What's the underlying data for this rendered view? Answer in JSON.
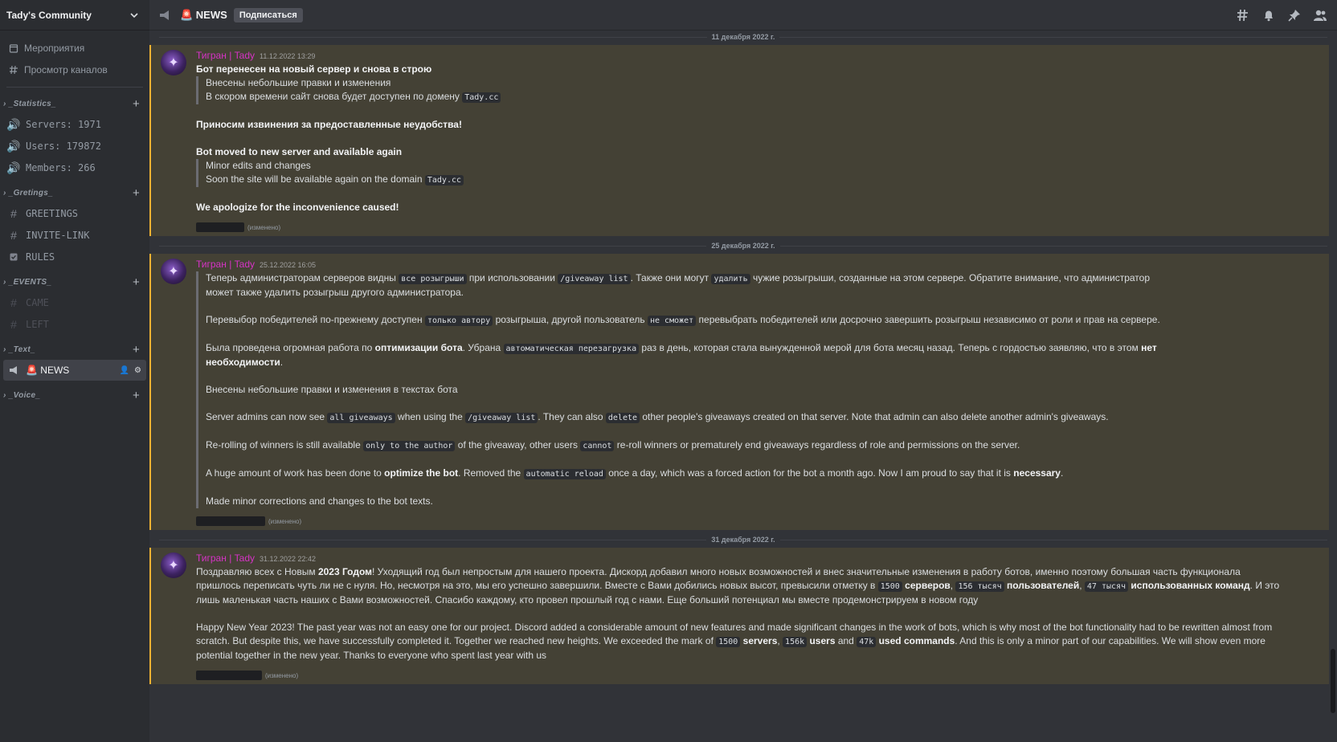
{
  "server": {
    "name": "Tady's Community"
  },
  "sidebar": {
    "top_items": [
      {
        "icon": "calendar-icon",
        "label": "Мероприятия"
      },
      {
        "icon": "browse-channels-icon",
        "label": "Просмотр каналов"
      }
    ],
    "categories": [
      {
        "name": "_Statistics_",
        "channels": [
          {
            "icon": "voice-icon",
            "label": "Servers: 1971"
          },
          {
            "icon": "voice-icon",
            "label": "Users: 179872"
          },
          {
            "icon": "voice-icon",
            "label": "Members: 266"
          }
        ]
      },
      {
        "name": "_Gretings_",
        "channels": [
          {
            "icon": "hash-icon",
            "label": "GREETINGS"
          },
          {
            "icon": "hash-icon",
            "label": "INVITE-LINK"
          },
          {
            "icon": "rules-icon",
            "label": "RULES"
          }
        ]
      },
      {
        "name": "_EVENTS_",
        "channels": [
          {
            "icon": "hash-icon",
            "label": "CAME"
          },
          {
            "icon": "hash-icon",
            "label": "LEFT"
          }
        ]
      },
      {
        "name": "_Text_",
        "channels": [
          {
            "icon": "announcement-icon",
            "label": "🚨 NEWS"
          }
        ]
      },
      {
        "name": "_Voice_",
        "channels": []
      }
    ]
  },
  "topbar": {
    "channel": "🚨 NEWS",
    "follow_label": "Подписаться",
    "icons": [
      "threads-icon",
      "bell-icon",
      "pin-icon",
      "members-icon"
    ]
  },
  "messages": [
    {
      "date_divider": "11 декабря 2022 г.",
      "author": "Тигран | Tady",
      "timestamp": "11.12.2022 13:29",
      "edited": "(изменено)"
    },
    {
      "date_divider": "25 декабря 2022 г.",
      "author": "Тигран | Tady",
      "timestamp": "25.12.2022 16:05",
      "edited": "(изменено)"
    },
    {
      "date_divider": "31 декабря 2022 г.",
      "author": "Тигран | Tady",
      "timestamp": "31.12.2022 22:42",
      "edited": "(изменено)"
    }
  ],
  "m1": {
    "ru_title": "Бот перенесен на новый сервер и снова в строю",
    "ru_q1": "Внесены небольшие правки и изменения",
    "ru_q2a": "В скором времени сайт снова будет доступен по домену ",
    "domain": "Tady.cc",
    "ru_apology": "Приносим извинения за предоставленные неудобства!",
    "en_title": "Bot moved to new server and available again",
    "en_q1": "Minor edits and changes",
    "en_q2a": "Soon the site will be available again on the domain ",
    "en_apology": "We apologize for the inconvenience caused!"
  },
  "m2": {
    "p1a": "Теперь администраторам серверов видны ",
    "p1c1": "все розыгрыши",
    "p1b": " при использовании ",
    "p1c2": "/giveaway list",
    "p1c": ". Также они могут ",
    "p1c3": "удалить",
    "p1d": " чужие розыгрыши, созданные на этом сервере. Обратите внимание, что администратор",
    "p1e": "может также удалить розыгрыш другого администратора.",
    "p2a": "Перевыбор победителей по-прежнему доступен ",
    "p2c1": "только автору",
    "p2b": " розыгрыша, другой пользователь ",
    "p2c2": "не сможет",
    "p2c": " перевыбрать победителей или досрочно завершить розыгрыш независимо от роли и прав на сервере.",
    "p3a": "Была проведена огромная работа по ",
    "p3b1": "оптимизации бота",
    "p3b": ". Убрана ",
    "p3c1": "автоматическая перезагрузка",
    "p3c": " раз в день, которая стала вынужденной мерой для бота месяц назад. Теперь с гордостью заявляю, что в этом ",
    "p3b2": "нет",
    "p3d": "необходимости",
    "p3e": ".",
    "p4": "Внесены небольшие правки и изменения в текстах бота",
    "e1a": "Server admins can now see ",
    "e1c1": "all giveaways",
    "e1b": " when using the ",
    "e1c2": "/giveaway list",
    "e1c": ". They can also ",
    "e1c3": "delete",
    "e1d": " other people's giveaways created on that server. Note that admin can also delete another admin's giveaways.",
    "e2a": "Re-rolling of winners is still available ",
    "e2c1": "only to the author",
    "e2b": " of the giveaway, other users ",
    "e2c2": "cannot",
    "e2c": " re-roll winners or prematurely end giveaways regardless of role and permissions on the server.",
    "e3a": "A huge amount of work has been done to ",
    "e3b1": "optimize the bot",
    "e3b": ". Removed the ",
    "e3c1": "automatic reload",
    "e3c": " once a day, which was a forced action for the bot a month ago. Now I am proud to say that it is ",
    "e3b2": "necessary",
    "e3d": ".",
    "e4": "Made minor corrections and changes to the bot texts."
  },
  "m3": {
    "r1a": "Поздравляю всех с Новым ",
    "r1b": "2023 Годом",
    "r1c": "! Уходящий год был непростым для нашего проекта. Дискорд добавил много новых возможностей и внес значительные изменения в работу ботов, именно поэтому большая часть функционала",
    "r2a": "пришлось переписать чуть ли не с нуля. Но, несмотря на это, мы его успешно завершили. Вместе с Вами добились новых высот, превысили отметку в ",
    "r2c1": "1500",
    "r2b1": " серверов",
    "r2s1": ", ",
    "r2c2": "156 тысяч",
    "r2b2": " пользователей",
    "r2s2": ", ",
    "r2c3": "47 тысяч",
    "r2b3": " использованных команд",
    "r2d": ". И это",
    "r3": "лишь маленькая часть наших с Вами возможностей. Спасибо каждому, кто провел прошлый год с нами. Еще больший потенциал мы вместе продемонстрируем в новом году",
    "e1": "Happy New Year 2023! The past year was not an easy one for our project. Discord added a considerable amount of new features and made significant changes in the work of bots, which is why most of the bot functionality had to be rewritten almost from",
    "e2a": "scratch. But despite this, we have successfully completed it. Together we reached new heights. We exceeded the mark of ",
    "e2c1": "1500",
    "e2b1": " servers",
    "e2s1": ", ",
    "e2c2": "156k",
    "e2b2": " users",
    "e2s2": " and ",
    "e2c3": "47k",
    "e2b3": " used commands",
    "e2d": ". And this is only a minor part of our capabilities. We will show even more",
    "e3": "potential together in the new year. Thanks to everyone who spent last year with us"
  }
}
